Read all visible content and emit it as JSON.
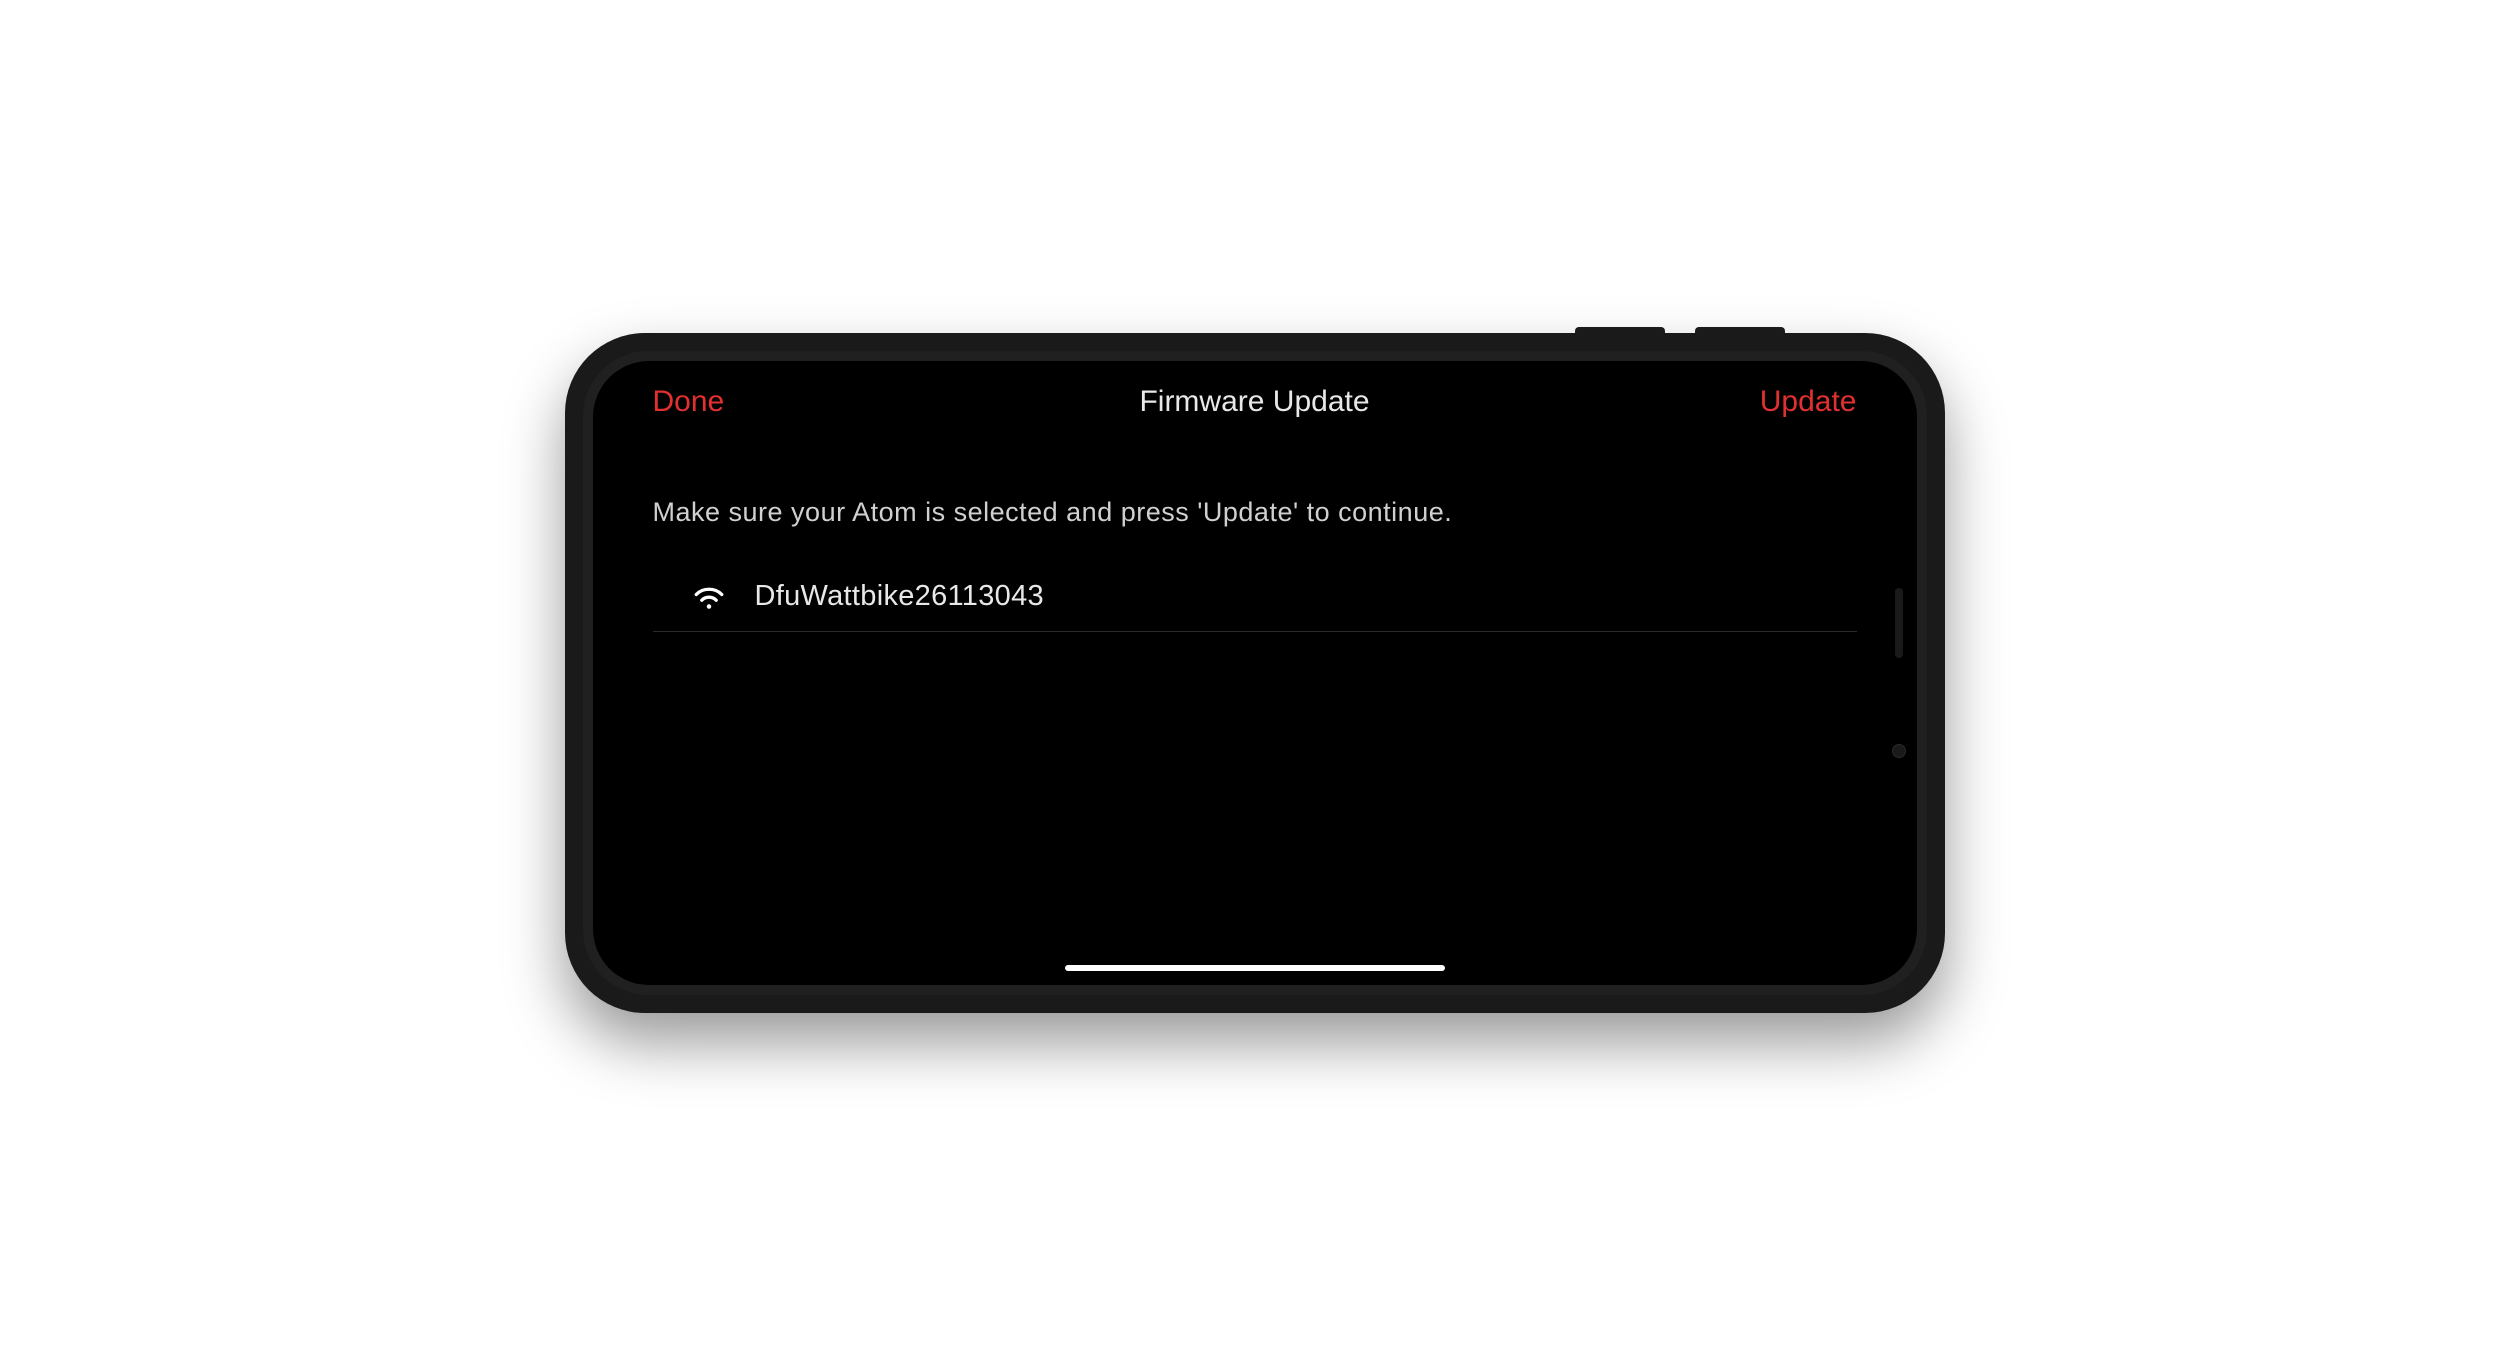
{
  "nav": {
    "done_label": "Done",
    "title": "Firmware Update",
    "update_label": "Update"
  },
  "content": {
    "instruction": "Make sure your Atom is selected and press 'Update' to continue."
  },
  "devices": [
    {
      "name": "DfuWattbike26113043",
      "signal_icon": "wifi-icon"
    }
  ],
  "colors": {
    "accent": "#e23030",
    "background": "#000000",
    "text_primary": "#e8e8e8",
    "text_secondary": "#d0d0d0"
  }
}
